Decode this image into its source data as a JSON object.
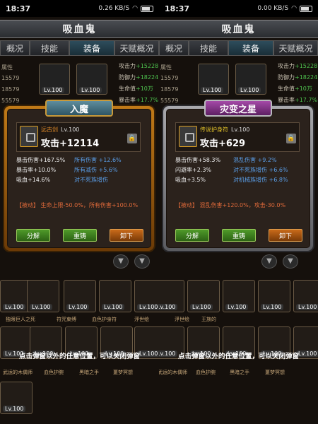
{
  "statusbar": {
    "left": {
      "time": "18:37",
      "speed": "0.26 KB/S"
    },
    "right": {
      "time": "18:37",
      "speed": "0.00 KB/S"
    }
  },
  "title": "吸血鬼",
  "tabs": [
    "概况",
    "技能",
    "装备",
    "天赋概况"
  ],
  "bg_stats": {
    "left_labels": [
      "属性",
      "15579",
      "18579",
      "55579"
    ],
    "right_labels": [
      {
        "label": "攻击力",
        "value": "+15228"
      },
      {
        "label": "防御力",
        "value": "+18224"
      },
      {
        "label": "生命值",
        "value": "+10万"
      },
      {
        "label": "暴击率",
        "value": "+17.7%"
      }
    ]
  },
  "popups": [
    {
      "banner": "入魔",
      "item_name": "远古剑",
      "item_level": "Lv.100",
      "main_stat": "攻击+12114",
      "subs": [
        {
          "left": "暴击伤害+167.5%",
          "right": "所有伤害 +12.6%"
        },
        {
          "left": "暴击率+10.0%",
          "right": "所有减伤 +5.6%"
        },
        {
          "left": "吸血+14.6%",
          "right": "对不死族增伤"
        }
      ],
      "passive": "【被动】 生命上限-50.0%，所有伤害+100.0%",
      "buttons": [
        "分解",
        "重铸",
        "卸下"
      ]
    },
    {
      "banner": "灾变之星",
      "item_name": "传说护身符",
      "item_level": "Lv.100",
      "main_stat": "攻击+629",
      "subs": [
        {
          "left": "暴击伤害+58.3%",
          "right": "混乱伤害 +9.2%"
        },
        {
          "left": "闪避率+2.3%",
          "right": "对不死族增伤 +6.6%"
        },
        {
          "left": "吸血+3.5%",
          "right": "对机械族增伤 +6.8%"
        }
      ],
      "passive": "【被动】 混乱伤害+120.0%，攻击-30.0%",
      "buttons": [
        "分解",
        "重铸",
        "卸下"
      ]
    }
  ],
  "grid": {
    "level": "Lv.100",
    "labels_row1": [
      "独眼巨人之死",
      "符咒束缚",
      "血色护身符",
      "浮世绘",
      "王族的"
    ],
    "labels_row2": [
      "武运的木偶师",
      "血色护腕",
      "黑暗之手",
      "噩梦冥想"
    ]
  },
  "hint": "点击弹窗以外的任意位置，可以关闭弹窗",
  "colors": {
    "gold_frame": "#c07a18",
    "silver_frame": "#a9a9ad",
    "sub_blue": "#5a9ee8",
    "passive_red": "#e06a3a",
    "stat_green": "#4ec24e"
  }
}
